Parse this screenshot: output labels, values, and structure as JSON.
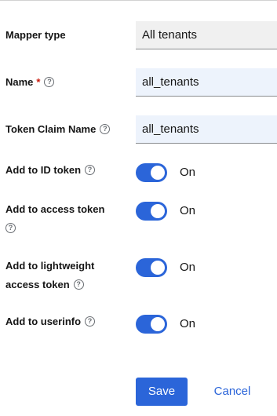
{
  "form": {
    "mapper_type": {
      "label": "Mapper type",
      "value": "All tenants"
    },
    "name": {
      "label": "Name",
      "required_mark": "*",
      "value": "all_tenants"
    },
    "token_claim_name": {
      "label": "Token Claim Name",
      "value": "all_tenants"
    },
    "add_to_id_token": {
      "label": "Add to ID token",
      "state": "On"
    },
    "add_to_access_token": {
      "label_line1": "Add to access token",
      "state": "On"
    },
    "add_to_lightweight_access_token": {
      "label_line1": "Add to lightweight",
      "label_line2": "access token",
      "state": "On"
    },
    "add_to_userinfo": {
      "label": "Add to userinfo",
      "state": "On"
    }
  },
  "actions": {
    "save_label": "Save",
    "cancel_label": "Cancel"
  },
  "help_glyph": "?",
  "colors": {
    "primary": "#2b65d9",
    "required": "#c9190b"
  }
}
